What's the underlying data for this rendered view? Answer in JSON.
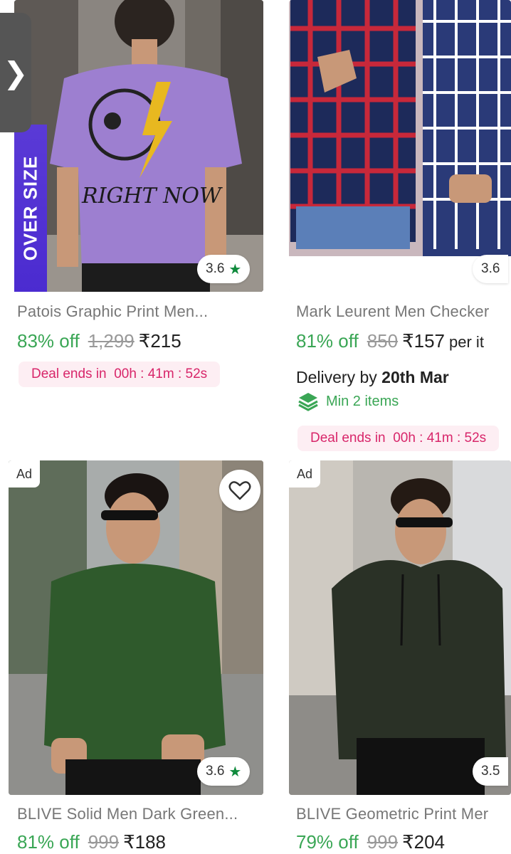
{
  "products": [
    {
      "title": "Patois Graphic Print Men...",
      "discount": "83% off",
      "mrp": "1,299",
      "price": "₹215",
      "rating": "3.6",
      "deal_label": "Deal ends in",
      "deal_time": "00h : 41m : 52s",
      "tag": "OVER SIZE",
      "print_text": "RIGHT NOW"
    },
    {
      "title": "Mark Leurent Men Checker",
      "discount": "81% off",
      "mrp": "850",
      "price": "₹157",
      "price_suffix": "per it",
      "rating": "3.6",
      "delivery_prefix": "Delivery by",
      "delivery_date": "20th Mar",
      "min_items": "Min 2 items",
      "deal_label": "Deal ends in",
      "deal_time": "00h : 41m : 52s"
    },
    {
      "ad": "Ad",
      "title": "BLIVE Solid Men Dark Green...",
      "discount": "81% off",
      "mrp": "999",
      "price": "₹188",
      "rating": "3.6"
    },
    {
      "ad": "Ad",
      "title": "BLIVE Geometric Print Mer",
      "discount": "79% off",
      "mrp": "999",
      "price": "₹204",
      "rating": "3.5"
    }
  ],
  "side_tab_glyph": "❯",
  "colors": {
    "discount_green": "#3aa655",
    "deal_pink": "#d8266a",
    "rating_star": "#0f8a3c",
    "oversize_purple": "#5a3ad6"
  },
  "icons": [
    "star-icon",
    "heart-icon",
    "chevron-right-icon",
    "layers-icon"
  ]
}
